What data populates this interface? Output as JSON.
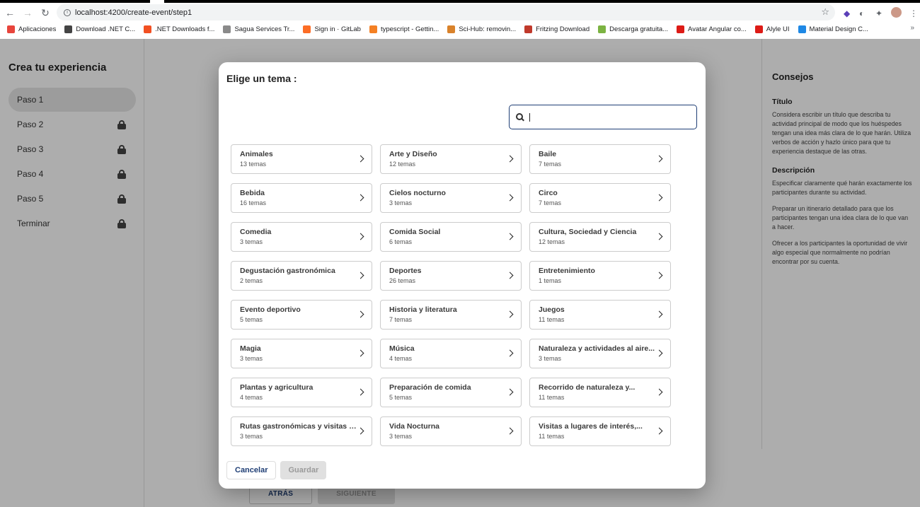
{
  "browser": {
    "url": "localhost:4200/create-event/step1",
    "bookmarks": [
      {
        "label": "Aplicaciones",
        "color": "#e8453c"
      },
      {
        "label": "Download .NET C...",
        "color": "#444444"
      },
      {
        "label": ".NET Downloads f...",
        "color": "#f25022"
      },
      {
        "label": "Sagua Services Tr...",
        "color": "#8a8a8a"
      },
      {
        "label": "Sign in · GitLab",
        "color": "#fc6d26"
      },
      {
        "label": "typescript - Gettin...",
        "color": "#f48024"
      },
      {
        "label": "Sci-Hub: removin...",
        "color": "#d9822b"
      },
      {
        "label": "Fritzing Download",
        "color": "#c0392b"
      },
      {
        "label": "Descarga gratuita...",
        "color": "#7cb342"
      },
      {
        "label": "Avatar Angular co...",
        "color": "#dd1b16"
      },
      {
        "label": "Alyle UI",
        "color": "#dd1b16"
      },
      {
        "label": "Material Design C...",
        "color": "#1e88e5"
      }
    ]
  },
  "sidebar": {
    "title": "Crea tu experiencia",
    "steps": [
      {
        "label": "Paso 1"
      },
      {
        "label": "Paso 2"
      },
      {
        "label": "Paso 3"
      },
      {
        "label": "Paso 4"
      },
      {
        "label": "Paso 5"
      },
      {
        "label": "Terminar"
      }
    ]
  },
  "tips": {
    "title": "Consejos",
    "title_heading": "Título",
    "title_text": "Considera escribir un título que describa tu actividad principal de modo que los huéspedes tengan una idea más clara de lo que harán. Utiliza verbos de acción y hazlo único para que tu experiencia destaque de las otras.",
    "desc_heading": "Descripción",
    "desc_p1": "Especificar claramente qué harán exactamente los participantes durante su actividad.",
    "desc_p2": "Preparar un itinerario detallado para que los participantes tengan una idea clara de lo que van a hacer.",
    "desc_p3": "Ofrecer a los participantes la oportunidad de vivir algo especial que normalmente no podrían encontrar por su cuenta."
  },
  "footer": {
    "back": "ATRÁS",
    "next": "SIGUIENTE"
  },
  "modal": {
    "title": "Elige un tema :",
    "search_value": "",
    "topics": [
      {
        "name": "Animales",
        "count": "13 temas"
      },
      {
        "name": "Arte y Diseño",
        "count": "12 temas"
      },
      {
        "name": "Baile",
        "count": "7 temas"
      },
      {
        "name": "Bebida",
        "count": "16 temas"
      },
      {
        "name": "Cielos nocturno",
        "count": "3 temas"
      },
      {
        "name": "Circo",
        "count": "7 temas"
      },
      {
        "name": "Comedia",
        "count": "3 temas"
      },
      {
        "name": "Comida Social",
        "count": "6 temas"
      },
      {
        "name": "Cultura, Sociedad y Ciencia",
        "count": "12 temas"
      },
      {
        "name": "Degustación gastronómica",
        "count": "2 temas"
      },
      {
        "name": "Deportes",
        "count": "26 temas"
      },
      {
        "name": "Entretenimiento",
        "count": "1 temas"
      },
      {
        "name": "Evento deportivo",
        "count": "5 temas"
      },
      {
        "name": "Historia y literatura",
        "count": "7 temas"
      },
      {
        "name": "Juegos",
        "count": "11 temas"
      },
      {
        "name": "Magia",
        "count": "3 temas"
      },
      {
        "name": "Música",
        "count": "4 temas"
      },
      {
        "name": "Naturaleza y actividades al aire...",
        "count": "3 temas"
      },
      {
        "name": "Plantas y agricultura",
        "count": "4 temas"
      },
      {
        "name": "Preparación de comida",
        "count": "5 temas"
      },
      {
        "name": "Recorrido de naturaleza y...",
        "count": "11 temas"
      },
      {
        "name": "Rutas gastronómicas y visitas a...",
        "count": "3 temas"
      },
      {
        "name": "Vida Nocturna",
        "count": "3 temas"
      },
      {
        "name": "Visitas a lugares de interés,...",
        "count": "11 temas"
      }
    ],
    "cancel": "Cancelar",
    "save": "Guardar"
  }
}
